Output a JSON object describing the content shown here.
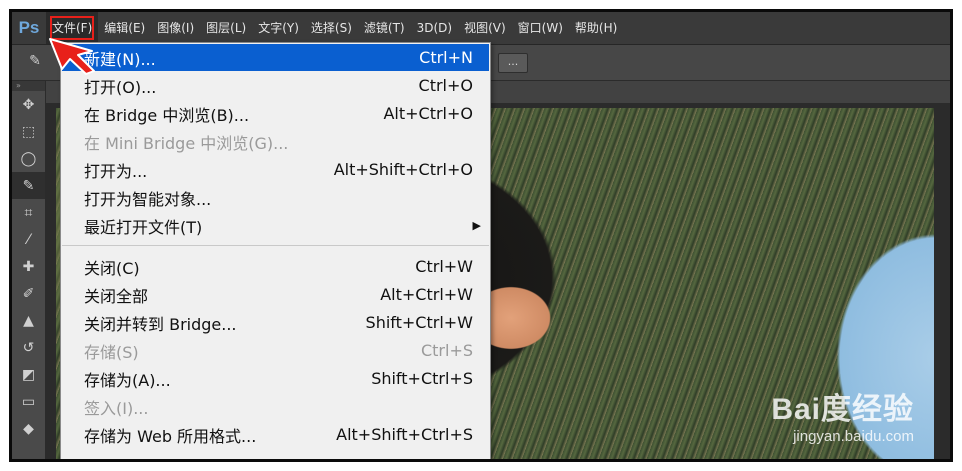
{
  "app": {
    "logo": "Ps"
  },
  "menubar": {
    "items": [
      "文件(F)",
      "编辑(E)",
      "图像(I)",
      "图层(L)",
      "文字(Y)",
      "选择(S)",
      "滤镜(T)",
      "3D(D)",
      "视图(V)",
      "窗口(W)",
      "帮助(H)"
    ]
  },
  "options_bar": {
    "button_label": "..."
  },
  "file_menu": {
    "items": [
      {
        "label": "新建(N)...",
        "shortcut": "Ctrl+N",
        "state": "highlighted"
      },
      {
        "label": "打开(O)...",
        "shortcut": "Ctrl+O",
        "state": "enabled"
      },
      {
        "label": "在 Bridge 中浏览(B)...",
        "shortcut": "Alt+Ctrl+O",
        "state": "enabled"
      },
      {
        "label": "在 Mini Bridge 中浏览(G)...",
        "shortcut": "",
        "state": "disabled"
      },
      {
        "label": "打开为...",
        "shortcut": "Alt+Shift+Ctrl+O",
        "state": "enabled"
      },
      {
        "label": "打开为智能对象...",
        "shortcut": "",
        "state": "enabled"
      },
      {
        "label": "最近打开文件(T)",
        "shortcut": "",
        "state": "enabled",
        "submenu": true
      },
      {
        "label": "关闭(C)",
        "shortcut": "Ctrl+W",
        "state": "enabled"
      },
      {
        "label": "关闭全部",
        "shortcut": "Alt+Ctrl+W",
        "state": "enabled"
      },
      {
        "label": "关闭并转到 Bridge...",
        "shortcut": "Shift+Ctrl+W",
        "state": "enabled"
      },
      {
        "label": "存储(S)",
        "shortcut": "Ctrl+S",
        "state": "disabled"
      },
      {
        "label": "存储为(A)...",
        "shortcut": "Shift+Ctrl+S",
        "state": "enabled"
      },
      {
        "label": "签入(I)...",
        "shortcut": "",
        "state": "disabled"
      },
      {
        "label": "存储为 Web 所用格式...",
        "shortcut": "Alt+Shift+Ctrl+S",
        "state": "enabled"
      }
    ]
  },
  "watermark": {
    "brand": "Bai度经验",
    "url": "jingyan.baidu.com"
  },
  "colors": {
    "highlight": "#0a5fd0",
    "annotation_red": "#e8201a",
    "logo_blue": "#6fa8dc"
  },
  "icons": [
    "move-icon",
    "marquee-icon",
    "lasso-icon",
    "quick-select-icon",
    "crop-icon",
    "eyedropper-icon",
    "healing-brush-icon",
    "brush-icon",
    "clone-stamp-icon",
    "history-brush-icon",
    "eraser-icon",
    "gradient-icon",
    "blur-icon"
  ]
}
